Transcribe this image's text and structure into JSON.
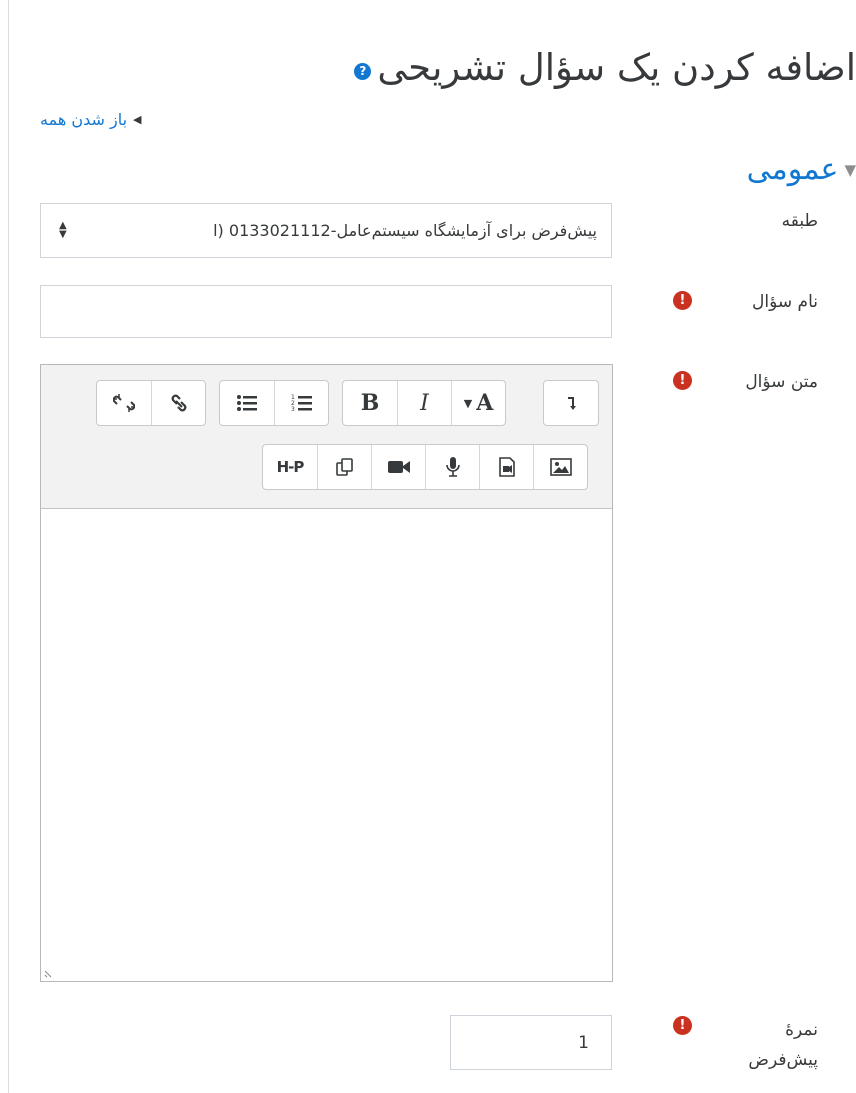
{
  "page": {
    "title": "اضافه کردن یک سؤال تشریحی",
    "help_icon": "question-circle-icon"
  },
  "expand_all": {
    "label": "باز شدن همه"
  },
  "section": {
    "title": "عمومی"
  },
  "fields": {
    "category": {
      "label": "طبقه",
      "selected": "پیش‌فرض برای آزمایشگاه سیستم‌عامل-0133021112 (ا"
    },
    "name": {
      "label": "نام سؤال",
      "value": ""
    },
    "text": {
      "label": "متن سؤال"
    },
    "default_mark": {
      "label_line1": "نمرهٔ",
      "label_line2": "پیش‌فرض",
      "value": "1"
    }
  },
  "editor": {
    "toolbar_row1": [
      "collapse",
      "font-color",
      "bold",
      "italic",
      "unordered-list",
      "ordered-list",
      "link",
      "unlink"
    ],
    "toolbar_row2": [
      "image",
      "media",
      "audio",
      "video",
      "manage-files",
      "h5p"
    ],
    "h5p_label": "H-P",
    "bold_label": "B",
    "italic_label": "I",
    "font_color_label": "A"
  },
  "colors": {
    "link": "#1177d1",
    "required": "#ca3120",
    "toolbar_bg": "#f2f2f2"
  }
}
